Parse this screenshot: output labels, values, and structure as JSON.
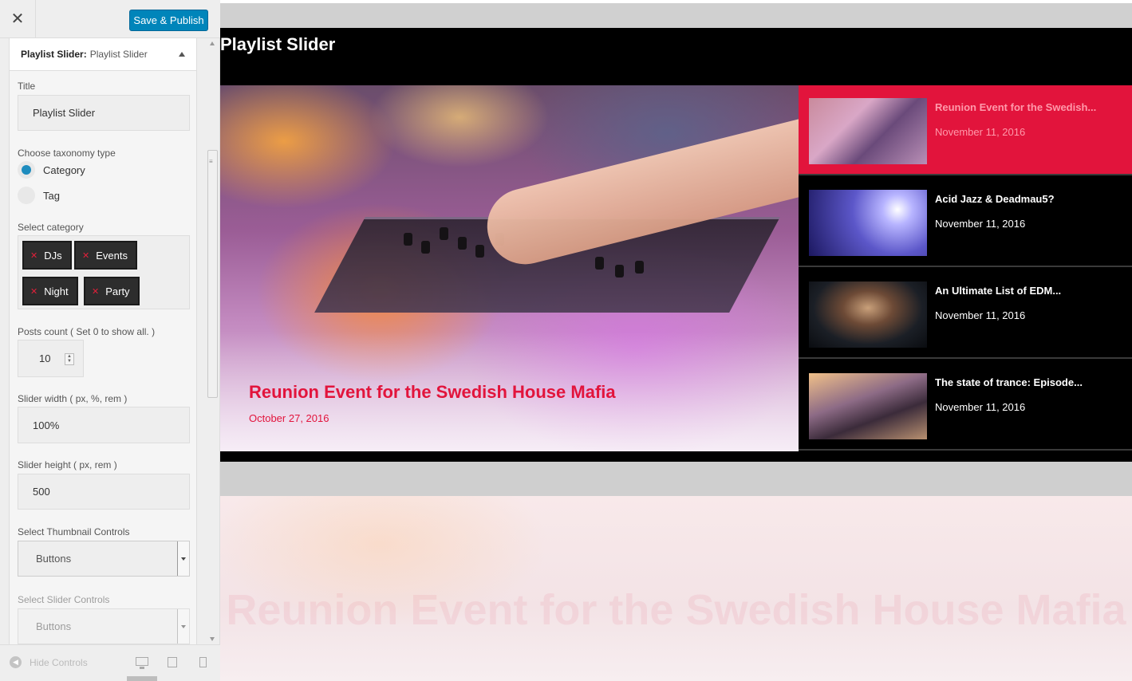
{
  "customizer": {
    "close_icon": "close-icon",
    "save_button": "Save & Publish",
    "panel": {
      "heading_bold": "Playlist Slider:",
      "heading_sub": "Playlist Slider"
    },
    "title_label": "Title",
    "title_value": "Playlist Slider",
    "taxonomy_label": "Choose taxonomy type",
    "taxonomy_options": [
      {
        "label": "Category",
        "selected": true
      },
      {
        "label": "Tag",
        "selected": false
      }
    ],
    "category_label": "Select category",
    "categories": [
      "DJs",
      "Events",
      "Night",
      "Party"
    ],
    "posts_count_label": "Posts count ( Set 0 to show all. )",
    "posts_count_value": "10",
    "slider_width_label": "Slider width ( px, %, rem )",
    "slider_width_value": "100%",
    "slider_height_label": "Slider height ( px, rem )",
    "slider_height_value": "500",
    "thumb_controls_label": "Select Thumbnail Controls",
    "thumb_controls_value": "Buttons",
    "slider_controls_label": "Select Slider Controls",
    "slider_controls_value": "Buttons",
    "footer": {
      "hide_controls": "Hide Controls"
    }
  },
  "preview": {
    "widget_title": "Playlist Slider",
    "main_slide": {
      "title": "Reunion Event for the Swedish House Mafia",
      "date": "October 27, 2016"
    },
    "playlist": [
      {
        "title": "Reunion Event for the Swedish...",
        "date": "November 11, 2016",
        "active": true
      },
      {
        "title": "Acid Jazz & Deadmau5?",
        "date": "November 11, 2016",
        "active": false
      },
      {
        "title": "An Ultimate List of EDM...",
        "date": "November 11, 2016",
        "active": false
      },
      {
        "title": "The state of trance: Episode...",
        "date": "November 11, 2016",
        "active": false
      }
    ],
    "ghost_title": "Reunion Event for the Swedish House Mafia"
  },
  "colors": {
    "accent": "#e2143c",
    "publish_button": "#0085ba",
    "radio_selected": "#1e8cbe"
  }
}
